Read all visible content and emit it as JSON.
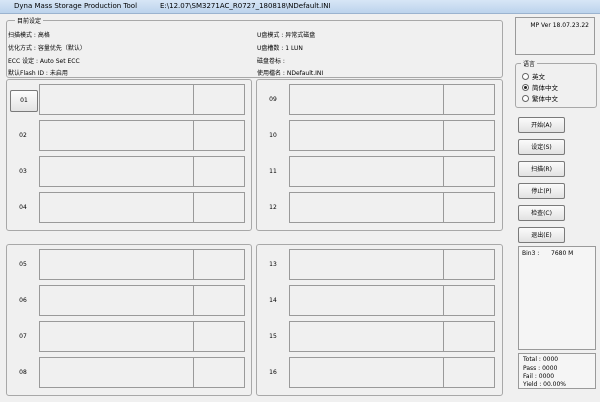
{
  "window": {
    "title": "Dyna Mass Storage Production Tool",
    "path": "E:\\12.07\\SM3271AC_R0727_180818\\NDefault.INI",
    "minimize": "—",
    "maximize": "□",
    "close": "✕"
  },
  "settings": {
    "group_label": "目前设定",
    "scan_mode": "扫描模式 : 高格",
    "optimize_mode": "优化方式 : 容量优先（默认）",
    "ecc_setting": "ECC 设定 : Auto Set ECC",
    "flash_id": "默认Flash ID : 未启用",
    "udisk_mode": "U盘模式 : 异常式磁盘",
    "udisk_count": "U盘槽数 : 1 LUN",
    "disk_label": "磁盘卷标 :",
    "config_name": "使用檔名 : NDefault.INI"
  },
  "slots": {
    "s01": "01",
    "s02": "02",
    "s03": "03",
    "s04": "04",
    "s05": "05",
    "s06": "06",
    "s07": "07",
    "s08": "08",
    "s09": "09",
    "s10": "10",
    "s11": "11",
    "s12": "12",
    "s13": "13",
    "s14": "14",
    "s15": "15",
    "s16": "16"
  },
  "version": "MP Ver 18.07.23.22",
  "language": {
    "label": "语言",
    "english": "英文",
    "simplified": "简体中文",
    "traditional": "繁体中文",
    "selected": "simplified"
  },
  "actions": {
    "start": "开始(A)",
    "settings": "设定(S)",
    "scan": "扫描(R)",
    "stop": "停止(P)",
    "reset": "检查(C)",
    "exit": "退出(E)"
  },
  "bin": {
    "label": "Bin3 :",
    "value": "7680 M"
  },
  "stats": {
    "total": "Total : 0000",
    "pass": "Pass : 0000",
    "fail": "Fail   : 0000",
    "yield": "Yield : 00.00%"
  }
}
